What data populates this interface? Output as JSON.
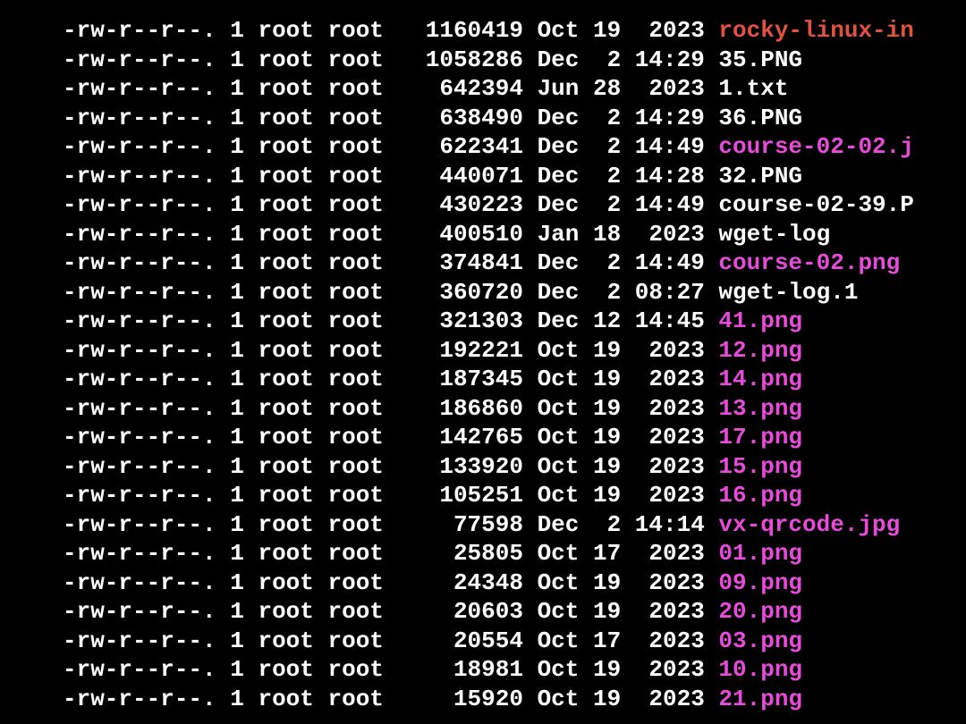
{
  "listing": [
    {
      "perms": "-rw-r--r--.",
      "links": "1",
      "owner": "root",
      "group": "root",
      "size": "1160419",
      "date": "Oct 19  2023",
      "name": "rocky-linux-in",
      "color": "red"
    },
    {
      "perms": "-rw-r--r--.",
      "links": "1",
      "owner": "root",
      "group": "root",
      "size": "1058286",
      "date": "Dec  2 14:29",
      "name": "35.PNG",
      "color": "white"
    },
    {
      "perms": "-rw-r--r--.",
      "links": "1",
      "owner": "root",
      "group": "root",
      "size": "642394",
      "date": "Jun 28  2023",
      "name": "1.txt",
      "color": "white"
    },
    {
      "perms": "-rw-r--r--.",
      "links": "1",
      "owner": "root",
      "group": "root",
      "size": "638490",
      "date": "Dec  2 14:29",
      "name": "36.PNG",
      "color": "white"
    },
    {
      "perms": "-rw-r--r--.",
      "links": "1",
      "owner": "root",
      "group": "root",
      "size": "622341",
      "date": "Dec  2 14:49",
      "name": "course-02-02.j",
      "color": "magenta"
    },
    {
      "perms": "-rw-r--r--.",
      "links": "1",
      "owner": "root",
      "group": "root",
      "size": "440071",
      "date": "Dec  2 14:28",
      "name": "32.PNG",
      "color": "white"
    },
    {
      "perms": "-rw-r--r--.",
      "links": "1",
      "owner": "root",
      "group": "root",
      "size": "430223",
      "date": "Dec  2 14:49",
      "name": "course-02-39.P",
      "color": "white"
    },
    {
      "perms": "-rw-r--r--.",
      "links": "1",
      "owner": "root",
      "group": "root",
      "size": "400510",
      "date": "Jan 18  2023",
      "name": "wget-log",
      "color": "white"
    },
    {
      "perms": "-rw-r--r--.",
      "links": "1",
      "owner": "root",
      "group": "root",
      "size": "374841",
      "date": "Dec  2 14:49",
      "name": "course-02.png",
      "color": "magenta"
    },
    {
      "perms": "-rw-r--r--.",
      "links": "1",
      "owner": "root",
      "group": "root",
      "size": "360720",
      "date": "Dec  2 08:27",
      "name": "wget-log.1",
      "color": "white"
    },
    {
      "perms": "-rw-r--r--.",
      "links": "1",
      "owner": "root",
      "group": "root",
      "size": "321303",
      "date": "Dec 12 14:45",
      "name": "41.png",
      "color": "magenta"
    },
    {
      "perms": "-rw-r--r--.",
      "links": "1",
      "owner": "root",
      "group": "root",
      "size": "192221",
      "date": "Oct 19  2023",
      "name": "12.png",
      "color": "magenta"
    },
    {
      "perms": "-rw-r--r--.",
      "links": "1",
      "owner": "root",
      "group": "root",
      "size": "187345",
      "date": "Oct 19  2023",
      "name": "14.png",
      "color": "magenta"
    },
    {
      "perms": "-rw-r--r--.",
      "links": "1",
      "owner": "root",
      "group": "root",
      "size": "186860",
      "date": "Oct 19  2023",
      "name": "13.png",
      "color": "magenta"
    },
    {
      "perms": "-rw-r--r--.",
      "links": "1",
      "owner": "root",
      "group": "root",
      "size": "142765",
      "date": "Oct 19  2023",
      "name": "17.png",
      "color": "magenta"
    },
    {
      "perms": "-rw-r--r--.",
      "links": "1",
      "owner": "root",
      "group": "root",
      "size": "133920",
      "date": "Oct 19  2023",
      "name": "15.png",
      "color": "magenta"
    },
    {
      "perms": "-rw-r--r--.",
      "links": "1",
      "owner": "root",
      "group": "root",
      "size": "105251",
      "date": "Oct 19  2023",
      "name": "16.png",
      "color": "magenta"
    },
    {
      "perms": "-rw-r--r--.",
      "links": "1",
      "owner": "root",
      "group": "root",
      "size": "77598",
      "date": "Dec  2 14:14",
      "name": "vx-qrcode.jpg",
      "color": "magenta"
    },
    {
      "perms": "-rw-r--r--.",
      "links": "1",
      "owner": "root",
      "group": "root",
      "size": "25805",
      "date": "Oct 17  2023",
      "name": "01.png",
      "color": "magenta"
    },
    {
      "perms": "-rw-r--r--.",
      "links": "1",
      "owner": "root",
      "group": "root",
      "size": "24348",
      "date": "Oct 19  2023",
      "name": "09.png",
      "color": "magenta"
    },
    {
      "perms": "-rw-r--r--.",
      "links": "1",
      "owner": "root",
      "group": "root",
      "size": "20603",
      "date": "Oct 19  2023",
      "name": "20.png",
      "color": "magenta"
    },
    {
      "perms": "-rw-r--r--.",
      "links": "1",
      "owner": "root",
      "group": "root",
      "size": "20554",
      "date": "Oct 17  2023",
      "name": "03.png",
      "color": "magenta"
    },
    {
      "perms": "-rw-r--r--.",
      "links": "1",
      "owner": "root",
      "group": "root",
      "size": "18981",
      "date": "Oct 19  2023",
      "name": "10.png",
      "color": "magenta"
    },
    {
      "perms": "-rw-r--r--.",
      "links": "1",
      "owner": "root",
      "group": "root",
      "size": "15920",
      "date": "Oct 19  2023",
      "name": "21.png",
      "color": "magenta"
    }
  ]
}
